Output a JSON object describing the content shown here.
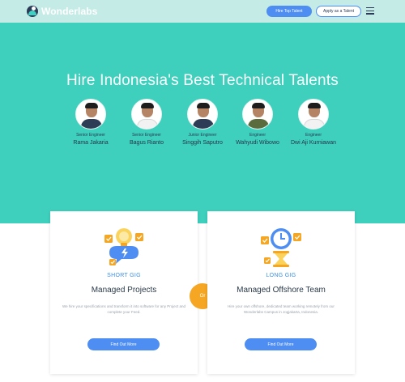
{
  "header": {
    "logo_text": "Wonderlabs",
    "hire_label": "Hire Top Talent",
    "apply_label": "Apply as a Talent"
  },
  "hero": {
    "title": "Hire Indonesia's Best Technical Talents",
    "talents": [
      {
        "role": "Senior Engineer",
        "name": "Rama Jakaria"
      },
      {
        "role": "Senior Engineer",
        "name": "Bagus Rianto"
      },
      {
        "role": "Junior Engineer",
        "name": "Singgih Saputro"
      },
      {
        "role": "Engineer",
        "name": "Wahyudi Wibowo"
      },
      {
        "role": "Engineer",
        "name": "Dwi Aji Kurniawan"
      }
    ]
  },
  "cards": [
    {
      "kicker": "SHORT GIG",
      "title": "Managed Projects",
      "desc": "We hire your specifications and transform it into software for any Project and complete your Feed.",
      "button": "Find Out More"
    },
    {
      "kicker": "LONG GIG",
      "title": "Managed Offshore Team",
      "desc": "Hire your own offshore, dedicated team working remotely from our Wonderlabs Campus in Jogjakarta, Indonesia.",
      "button": "Find Out More"
    }
  ],
  "or_label": "Or",
  "colors": {
    "hero_bg": "#3ecfbd",
    "header_bg": "#c4ebe6",
    "accent_blue": "#4e8ef2",
    "or_orange": "#f5a623"
  }
}
